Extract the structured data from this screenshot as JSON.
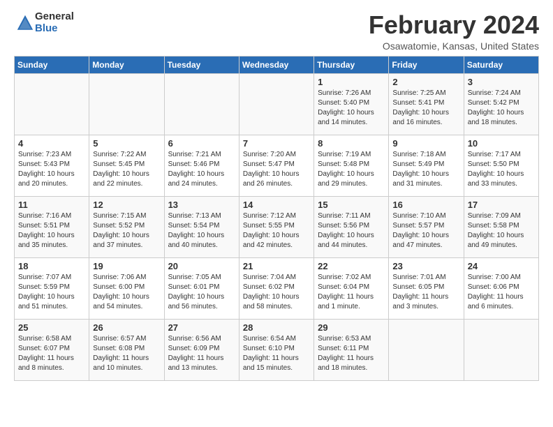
{
  "logo": {
    "general": "General",
    "blue": "Blue"
  },
  "title": "February 2024",
  "location": "Osawatomie, Kansas, United States",
  "days_of_week": [
    "Sunday",
    "Monday",
    "Tuesday",
    "Wednesday",
    "Thursday",
    "Friday",
    "Saturday"
  ],
  "weeks": [
    [
      {
        "day": "",
        "info": ""
      },
      {
        "day": "",
        "info": ""
      },
      {
        "day": "",
        "info": ""
      },
      {
        "day": "",
        "info": ""
      },
      {
        "day": "1",
        "info": "Sunrise: 7:26 AM\nSunset: 5:40 PM\nDaylight: 10 hours\nand 14 minutes."
      },
      {
        "day": "2",
        "info": "Sunrise: 7:25 AM\nSunset: 5:41 PM\nDaylight: 10 hours\nand 16 minutes."
      },
      {
        "day": "3",
        "info": "Sunrise: 7:24 AM\nSunset: 5:42 PM\nDaylight: 10 hours\nand 18 minutes."
      }
    ],
    [
      {
        "day": "4",
        "info": "Sunrise: 7:23 AM\nSunset: 5:43 PM\nDaylight: 10 hours\nand 20 minutes."
      },
      {
        "day": "5",
        "info": "Sunrise: 7:22 AM\nSunset: 5:45 PM\nDaylight: 10 hours\nand 22 minutes."
      },
      {
        "day": "6",
        "info": "Sunrise: 7:21 AM\nSunset: 5:46 PM\nDaylight: 10 hours\nand 24 minutes."
      },
      {
        "day": "7",
        "info": "Sunrise: 7:20 AM\nSunset: 5:47 PM\nDaylight: 10 hours\nand 26 minutes."
      },
      {
        "day": "8",
        "info": "Sunrise: 7:19 AM\nSunset: 5:48 PM\nDaylight: 10 hours\nand 29 minutes."
      },
      {
        "day": "9",
        "info": "Sunrise: 7:18 AM\nSunset: 5:49 PM\nDaylight: 10 hours\nand 31 minutes."
      },
      {
        "day": "10",
        "info": "Sunrise: 7:17 AM\nSunset: 5:50 PM\nDaylight: 10 hours\nand 33 minutes."
      }
    ],
    [
      {
        "day": "11",
        "info": "Sunrise: 7:16 AM\nSunset: 5:51 PM\nDaylight: 10 hours\nand 35 minutes."
      },
      {
        "day": "12",
        "info": "Sunrise: 7:15 AM\nSunset: 5:52 PM\nDaylight: 10 hours\nand 37 minutes."
      },
      {
        "day": "13",
        "info": "Sunrise: 7:13 AM\nSunset: 5:54 PM\nDaylight: 10 hours\nand 40 minutes."
      },
      {
        "day": "14",
        "info": "Sunrise: 7:12 AM\nSunset: 5:55 PM\nDaylight: 10 hours\nand 42 minutes."
      },
      {
        "day": "15",
        "info": "Sunrise: 7:11 AM\nSunset: 5:56 PM\nDaylight: 10 hours\nand 44 minutes."
      },
      {
        "day": "16",
        "info": "Sunrise: 7:10 AM\nSunset: 5:57 PM\nDaylight: 10 hours\nand 47 minutes."
      },
      {
        "day": "17",
        "info": "Sunrise: 7:09 AM\nSunset: 5:58 PM\nDaylight: 10 hours\nand 49 minutes."
      }
    ],
    [
      {
        "day": "18",
        "info": "Sunrise: 7:07 AM\nSunset: 5:59 PM\nDaylight: 10 hours\nand 51 minutes."
      },
      {
        "day": "19",
        "info": "Sunrise: 7:06 AM\nSunset: 6:00 PM\nDaylight: 10 hours\nand 54 minutes."
      },
      {
        "day": "20",
        "info": "Sunrise: 7:05 AM\nSunset: 6:01 PM\nDaylight: 10 hours\nand 56 minutes."
      },
      {
        "day": "21",
        "info": "Sunrise: 7:04 AM\nSunset: 6:02 PM\nDaylight: 10 hours\nand 58 minutes."
      },
      {
        "day": "22",
        "info": "Sunrise: 7:02 AM\nSunset: 6:04 PM\nDaylight: 11 hours\nand 1 minute."
      },
      {
        "day": "23",
        "info": "Sunrise: 7:01 AM\nSunset: 6:05 PM\nDaylight: 11 hours\nand 3 minutes."
      },
      {
        "day": "24",
        "info": "Sunrise: 7:00 AM\nSunset: 6:06 PM\nDaylight: 11 hours\nand 6 minutes."
      }
    ],
    [
      {
        "day": "25",
        "info": "Sunrise: 6:58 AM\nSunset: 6:07 PM\nDaylight: 11 hours\nand 8 minutes."
      },
      {
        "day": "26",
        "info": "Sunrise: 6:57 AM\nSunset: 6:08 PM\nDaylight: 11 hours\nand 10 minutes."
      },
      {
        "day": "27",
        "info": "Sunrise: 6:56 AM\nSunset: 6:09 PM\nDaylight: 11 hours\nand 13 minutes."
      },
      {
        "day": "28",
        "info": "Sunrise: 6:54 AM\nSunset: 6:10 PM\nDaylight: 11 hours\nand 15 minutes."
      },
      {
        "day": "29",
        "info": "Sunrise: 6:53 AM\nSunset: 6:11 PM\nDaylight: 11 hours\nand 18 minutes."
      },
      {
        "day": "",
        "info": ""
      },
      {
        "day": "",
        "info": ""
      }
    ]
  ]
}
